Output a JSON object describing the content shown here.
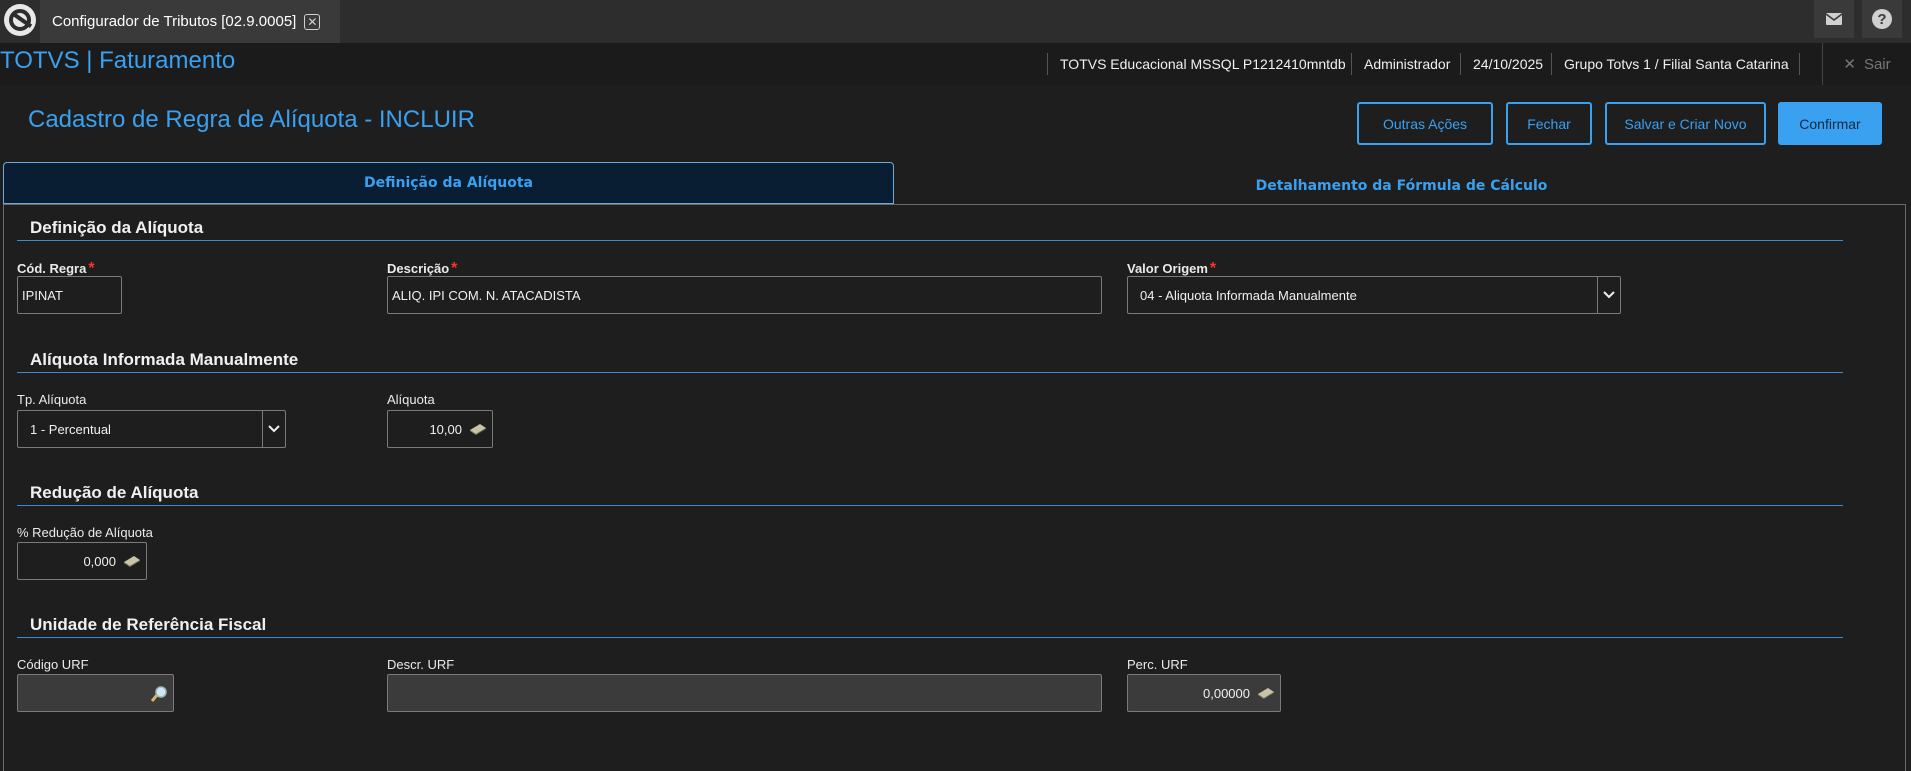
{
  "topbar": {
    "app_tab_title": "Configurador de Tributos [02.9.0005]",
    "icons": [
      "totvs-logo-icon",
      "close-icon",
      "mail-icon",
      "help-icon"
    ]
  },
  "header": {
    "brand": "TOTVS | Faturamento",
    "environment": "TOTVS Educacional MSSQL P1212410mntdb",
    "user": "Administrador",
    "date": "24/10/2025",
    "branch": "Grupo Totvs 1 / Filial Santa Catarina",
    "exit_label": "Sair"
  },
  "page": {
    "title": "Cadastro de Regra de Alíquota - INCLUIR",
    "buttons": {
      "other_actions": "Outras Ações",
      "close": "Fechar",
      "save_new": "Salvar e Criar Novo",
      "confirm": "Confirmar"
    }
  },
  "tabs": [
    {
      "label": "Definição da Alíquota",
      "active": true
    },
    {
      "label": "Detalhamento da Fórmula de Cálculo",
      "active": false
    }
  ],
  "sections": {
    "definicao": {
      "title": "Definição da Alíquota",
      "cod_regra": {
        "label": "Cód. Regra",
        "value": "IPINAT"
      },
      "descricao": {
        "label": "Descrição",
        "value": "ALIQ. IPI COM. N. ATACADISTA"
      },
      "valor_origem": {
        "label": "Valor Origem",
        "value": "04 - Aliquota Informada Manualmente"
      }
    },
    "aliquota_manual": {
      "title": "Alíquota Informada Manualmente",
      "tp_aliquota": {
        "label": "Tp. Alíquota",
        "value": "1 - Percentual"
      },
      "aliquota": {
        "label": "Alíquota",
        "value": "10,00"
      }
    },
    "reducao": {
      "title": "Redução de Alíquota",
      "perc_reducao": {
        "label": "% Redução de Alíquota",
        "value": "0,000"
      }
    },
    "urf": {
      "title": "Unidade de Referência Fiscal",
      "codigo": {
        "label": "Código URF",
        "value": ""
      },
      "descr": {
        "label": "Descr. URF",
        "value": ""
      },
      "perc": {
        "label": "Perc. URF",
        "value": "0,00000"
      }
    }
  },
  "colors": {
    "accent": "#3aa0f0",
    "background": "#1e1e1e",
    "required": "#ff3030"
  }
}
